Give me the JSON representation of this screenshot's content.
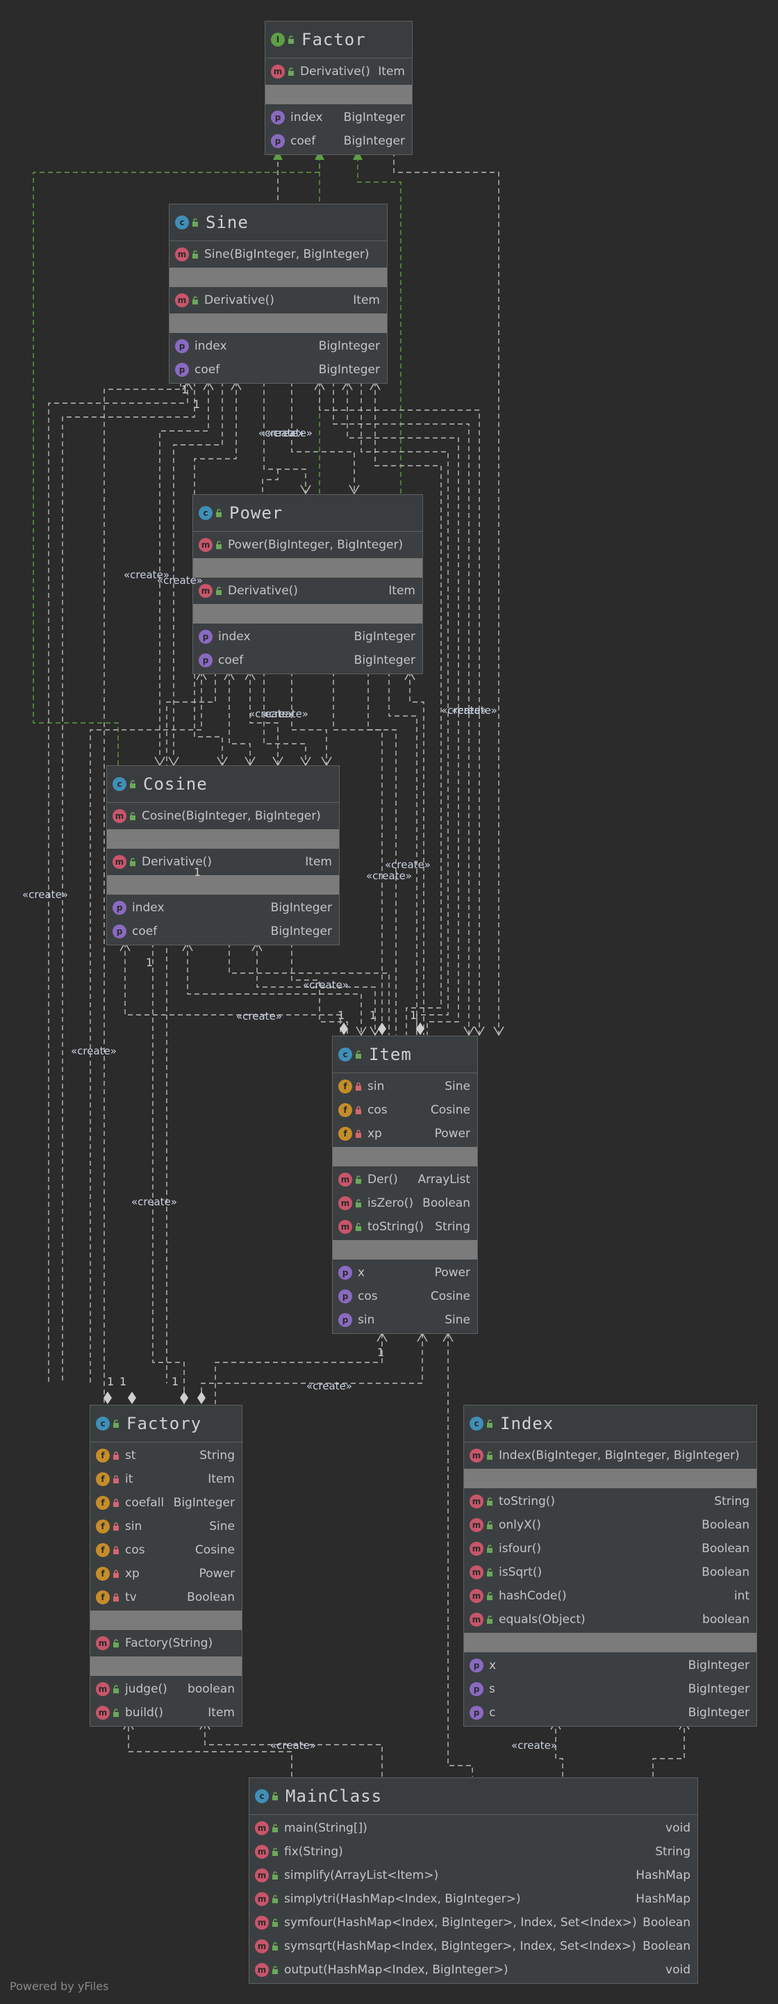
{
  "classes": {
    "factor": {
      "name": "Factor",
      "kind": "interface",
      "members": [
        {
          "badge": "m",
          "name": "Derivative()",
          "type": "Item"
        },
        {
          "badge": "p",
          "name": "index",
          "type": "BigInteger"
        },
        {
          "badge": "p",
          "name": "coef",
          "type": "BigInteger"
        }
      ]
    },
    "sine": {
      "name": "Sine",
      "members": [
        {
          "badge": "m",
          "name": "Sine(BigInteger, BigInteger)",
          "type": ""
        },
        {
          "badge": "m",
          "name": "Derivative()",
          "type": "Item"
        },
        {
          "badge": "p",
          "name": "index",
          "type": "BigInteger"
        },
        {
          "badge": "p",
          "name": "coef",
          "type": "BigInteger"
        }
      ]
    },
    "power": {
      "name": "Power",
      "members": [
        {
          "badge": "m",
          "name": "Power(BigInteger, BigInteger)",
          "type": ""
        },
        {
          "badge": "m",
          "name": "Derivative()",
          "type": "Item"
        },
        {
          "badge": "p",
          "name": "index",
          "type": "BigInteger"
        },
        {
          "badge": "p",
          "name": "coef",
          "type": "BigInteger"
        }
      ]
    },
    "cosine": {
      "name": "Cosine",
      "members": [
        {
          "badge": "m",
          "name": "Cosine(BigInteger, BigInteger)",
          "type": ""
        },
        {
          "badge": "m",
          "name": "Derivative()",
          "type": "Item"
        },
        {
          "badge": "p",
          "name": "index",
          "type": "BigInteger"
        },
        {
          "badge": "p",
          "name": "coef",
          "type": "BigInteger"
        }
      ]
    },
    "item": {
      "name": "Item",
      "members": [
        {
          "badge": "f",
          "name": "sin",
          "type": "Sine"
        },
        {
          "badge": "f",
          "name": "cos",
          "type": "Cosine"
        },
        {
          "badge": "f",
          "name": "xp",
          "type": "Power"
        },
        {
          "badge": "m",
          "name": "Der()",
          "type": "ArrayList"
        },
        {
          "badge": "m",
          "name": "isZero()",
          "type": "Boolean"
        },
        {
          "badge": "m",
          "name": "toString()",
          "type": "String"
        },
        {
          "badge": "p",
          "name": "x",
          "type": "Power"
        },
        {
          "badge": "p",
          "name": "cos",
          "type": "Cosine"
        },
        {
          "badge": "p",
          "name": "sin",
          "type": "Sine"
        }
      ]
    },
    "factory": {
      "name": "Factory",
      "members": [
        {
          "badge": "f",
          "name": "st",
          "type": "String"
        },
        {
          "badge": "f",
          "name": "it",
          "type": "Item"
        },
        {
          "badge": "f",
          "name": "coefall",
          "type": "BigInteger"
        },
        {
          "badge": "f",
          "name": "sin",
          "type": "Sine"
        },
        {
          "badge": "f",
          "name": "cos",
          "type": "Cosine"
        },
        {
          "badge": "f",
          "name": "xp",
          "type": "Power"
        },
        {
          "badge": "f",
          "name": "tv",
          "type": "Boolean"
        },
        {
          "badge": "m",
          "name": "Factory(String)",
          "type": ""
        },
        {
          "badge": "m",
          "name": "judge()",
          "type": "boolean"
        },
        {
          "badge": "m",
          "name": "build()",
          "type": "Item"
        }
      ]
    },
    "index": {
      "name": "Index",
      "members": [
        {
          "badge": "m",
          "name": "Index(BigInteger, BigInteger, BigInteger)",
          "type": ""
        },
        {
          "badge": "m",
          "name": "toString()",
          "type": "String"
        },
        {
          "badge": "m",
          "name": "onlyX()",
          "type": "Boolean"
        },
        {
          "badge": "m",
          "name": "isfour()",
          "type": "Boolean"
        },
        {
          "badge": "m",
          "name": "isSqrt()",
          "type": "Boolean"
        },
        {
          "badge": "m",
          "name": "hashCode()",
          "type": "int"
        },
        {
          "badge": "m",
          "name": "equals(Object)",
          "type": "boolean"
        },
        {
          "badge": "p",
          "name": "x",
          "type": "BigInteger"
        },
        {
          "badge": "p",
          "name": "s",
          "type": "BigInteger"
        },
        {
          "badge": "p",
          "name": "c",
          "type": "BigInteger"
        }
      ]
    },
    "mainclass": {
      "name": "MainClass",
      "members": [
        {
          "badge": "m",
          "name": "main(String[])",
          "type": "void"
        },
        {
          "badge": "m",
          "name": "fix(String)",
          "type": "String"
        },
        {
          "badge": "m",
          "name": "simplify(ArrayList<Item>)",
          "type": "HashMap"
        },
        {
          "badge": "m",
          "name": "simplytri(HashMap<Index, BigInteger>)",
          "type": "HashMap"
        },
        {
          "badge": "m",
          "name": "symfour(HashMap<Index, BigInteger>, Index, Set<Index>)",
          "type": "Boolean"
        },
        {
          "badge": "m",
          "name": "symsqrt(HashMap<Index, BigInteger>, Index, Set<Index>)",
          "type": "Boolean"
        },
        {
          "badge": "m",
          "name": "output(HashMap<Index, BigInteger>)",
          "type": "void"
        }
      ]
    }
  },
  "labels": {
    "create": "«create»",
    "one": "1"
  },
  "footer": "Powered by yFiles",
  "colors": {
    "background": "#2b2b2b",
    "edge": "#bbbbbb",
    "realization": "#5e9e44"
  }
}
